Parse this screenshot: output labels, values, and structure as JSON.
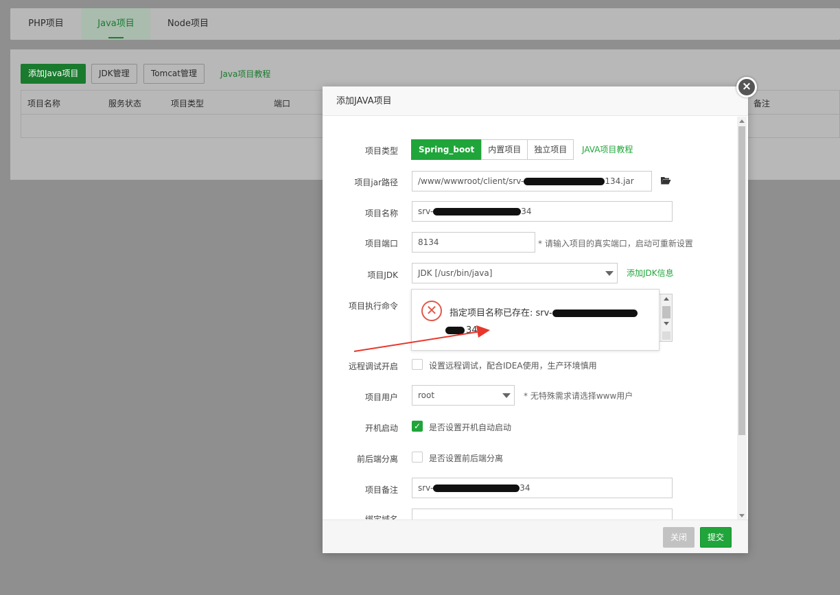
{
  "tabs": [
    {
      "label": "PHP项目"
    },
    {
      "label": "Java项目"
    },
    {
      "label": "Node项目"
    }
  ],
  "toolbar": {
    "add_button": "添加Java项目",
    "jdk_button": "JDK管理",
    "tomcat_button": "Tomcat管理",
    "tutorial_link": "Java项目教程"
  },
  "table": {
    "headers": [
      "项目名称",
      "服务状态",
      "项目类型",
      "端口",
      "备注"
    ]
  },
  "modal": {
    "title": "添加JAVA项目",
    "close_icon": "×",
    "fields": {
      "type_label": "项目类型",
      "type_options": [
        "Spring_boot",
        "内置项目",
        "独立项目"
      ],
      "type_tutorial": "JAVA项目教程",
      "jar_label": "项目jar路径",
      "jar_value_prefix": "/www/wwwroot/client/srv-",
      "jar_value_suffix": "134.jar",
      "folder_icon": "folder-open-icon",
      "name_label": "项目名称",
      "name_prefix": "srv-",
      "name_suffix": "34",
      "port_label": "项目端口",
      "port_value": "8134",
      "port_hint": "* 请输入项目的真实端口，启动可重新设置",
      "jdk_label": "项目JDK",
      "jdk_value": "JDK [/usr/bin/java]",
      "jdk_add": "添加JDK信息",
      "cmd_label": "项目执行命令",
      "debug_label": "远程调试开启",
      "debug_text": "设置远程调试，配合IDEA使用，生产环境慎用",
      "user_label": "项目用户",
      "user_value": "root",
      "user_hint": "* 无特殊需求请选择www用户",
      "boot_label": "开机启动",
      "boot_text": "是否设置开机自动启动",
      "split_label": "前后端分离",
      "split_text": "是否设置前后端分离",
      "remark_label": "项目备注",
      "remark_prefix": "srv-",
      "remark_suffix": "34",
      "domain_label": "绑定域名"
    },
    "toast": {
      "message_prefix": "指定项目名称已存在: srv-",
      "message_suffix": "34"
    },
    "footer": {
      "close": "关闭",
      "submit": "提交"
    }
  },
  "colors": {
    "accent": "#20a53a",
    "error": "#e0584a",
    "arrow": "#e8362b"
  }
}
